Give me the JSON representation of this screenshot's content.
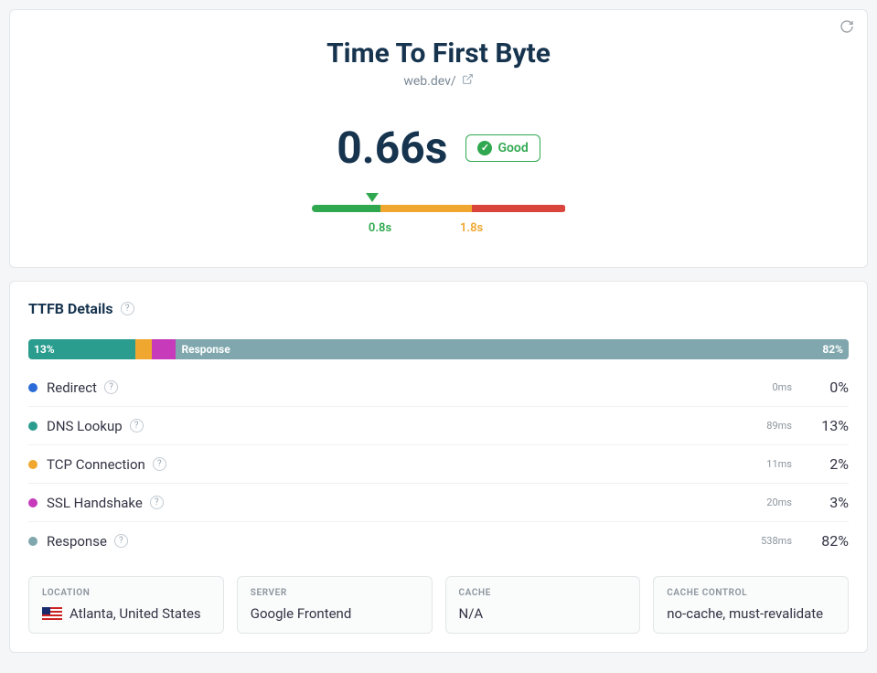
{
  "header": {
    "title": "Time To First Byte",
    "url": "web.dev/",
    "value": "0.66s",
    "badge": "Good"
  },
  "scale": {
    "marker_pct": 24,
    "t1_label": "0.8s",
    "t1_pct": 27,
    "t2_label": "1.8s",
    "t2_pct": 63
  },
  "details": {
    "title": "TTFB Details",
    "bar": {
      "dns_pct_label": "13%",
      "resp_label": "Response",
      "resp_pct_label": "82%"
    },
    "rows": [
      {
        "label": "Redirect",
        "color": "#2a6bd8",
        "ms": "0ms",
        "pct": "0%"
      },
      {
        "label": "DNS Lookup",
        "color": "#2a9d8f",
        "ms": "89ms",
        "pct": "13%"
      },
      {
        "label": "TCP Connection",
        "color": "#f0a72f",
        "ms": "11ms",
        "pct": "2%"
      },
      {
        "label": "SSL Handshake",
        "color": "#c73bbb",
        "ms": "20ms",
        "pct": "3%"
      },
      {
        "label": "Response",
        "color": "#7fa7ad",
        "ms": "538ms",
        "pct": "82%"
      }
    ]
  },
  "info": {
    "location_title": "LOCATION",
    "location": "Atlanta, United States",
    "server_title": "SERVER",
    "server": "Google Frontend",
    "cache_title": "CACHE",
    "cache": "N/A",
    "cache_control_title": "CACHE CONTROL",
    "cache_control": "no-cache, must-revalidate"
  },
  "chart_data": {
    "type": "bar",
    "title": "TTFB Details",
    "categories": [
      "Redirect",
      "DNS Lookup",
      "TCP Connection",
      "SSL Handshake",
      "Response"
    ],
    "values_ms": [
      0,
      89,
      11,
      20,
      538
    ],
    "values_pct": [
      0,
      13,
      2,
      3,
      82
    ],
    "thresholds_s": {
      "good": 0.8,
      "needs_improvement": 1.8
    },
    "measured_s": 0.66
  }
}
